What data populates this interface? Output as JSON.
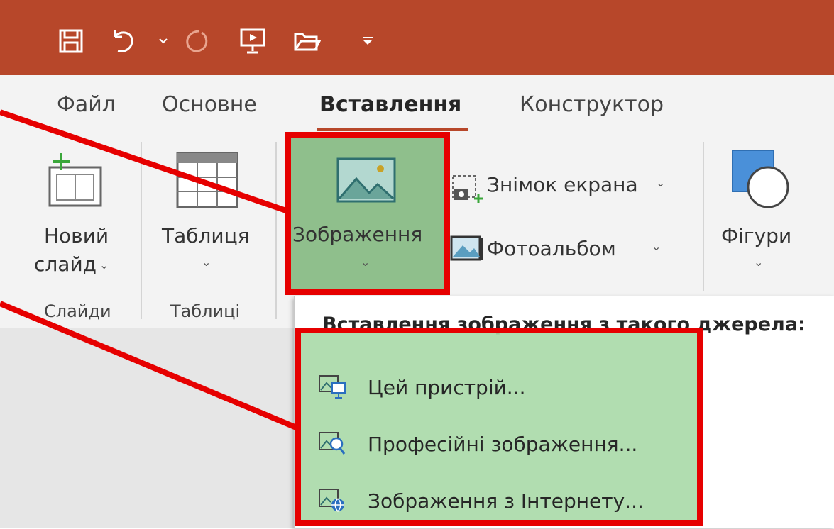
{
  "tabs": [
    {
      "label": "Файл"
    },
    {
      "label": "Основне"
    },
    {
      "label": "Вставлення"
    },
    {
      "label": "Конструктор"
    }
  ],
  "ribbon": {
    "new_slide_line1": "Новий",
    "new_slide_line2": "слайд",
    "table": "Таблиця",
    "images": "Зображення",
    "screenshot": "Знімок екрана",
    "photo_album": "Фотоальбом",
    "shapes": "Фігури",
    "group_slides": "Слайди",
    "group_tables": "Таблиці"
  },
  "dropdown": {
    "header": "Вставлення зображення з такого джерела:",
    "items": [
      {
        "icon": "picture-device-icon",
        "label": "Цей пристрій..."
      },
      {
        "icon": "picture-search-icon",
        "label": "Професійні зображення..."
      },
      {
        "icon": "picture-globe-icon",
        "label": "Зображення з Інтернету..."
      }
    ]
  },
  "colors": {
    "title_bar": "#b7472a",
    "highlight": "#a9d9a7",
    "annotation": "#e60000"
  }
}
